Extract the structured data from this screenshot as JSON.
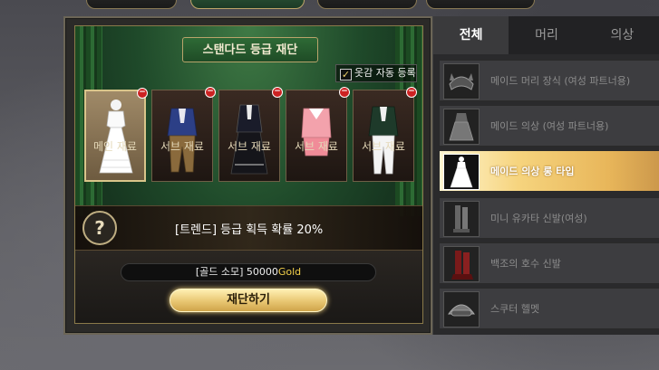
{
  "panel": {
    "title": "스탠다드 등급 재단",
    "auto_register_label": "옷감 자동 등록",
    "auto_register_checked": true,
    "slots": [
      {
        "label": "메인 재료",
        "icon": "maid-dress-white",
        "main": true
      },
      {
        "label": "서브 재료",
        "icon": "blue-jacket-outfit",
        "main": false
      },
      {
        "label": "서브 재료",
        "icon": "black-formal-dress",
        "main": false
      },
      {
        "label": "서브 재료",
        "icon": "pink-sailor-outfit",
        "main": false
      },
      {
        "label": "서브 재료",
        "icon": "green-suit-outfit",
        "main": false
      }
    ],
    "help_symbol": "?",
    "info_text": "[트렌드] 등급 획득 확률 20%",
    "cost_label": "[골드 소모] 50000",
    "cost_unit": "Gold",
    "craft_button": "재단하기"
  },
  "list": {
    "tabs": [
      "전체",
      "머리",
      "의상"
    ],
    "active_tab": 0,
    "items": [
      {
        "name": "메이드 머리 장식 (여성 파트너용)",
        "icon": "maid-headdress-icon",
        "selected": false
      },
      {
        "name": "메이드 의상 (여성 파트너용)",
        "icon": "maid-outfit-icon",
        "selected": false
      },
      {
        "name": "메이드 의상 롱 타입",
        "icon": "maid-long-dress-icon",
        "selected": true
      },
      {
        "name": "미니 유카타 신발(여성)",
        "icon": "yukata-shoes-icon",
        "selected": false
      },
      {
        "name": "백조의 호수 신발",
        "icon": "swan-lake-shoes-icon",
        "selected": false
      },
      {
        "name": "스쿠터 헬멧",
        "icon": "scooter-helmet-icon",
        "selected": false
      }
    ]
  },
  "colors": {
    "accent_gold": "#f3d04a",
    "remove_red": "#cc2222",
    "panel_green": "#1f4c26"
  }
}
